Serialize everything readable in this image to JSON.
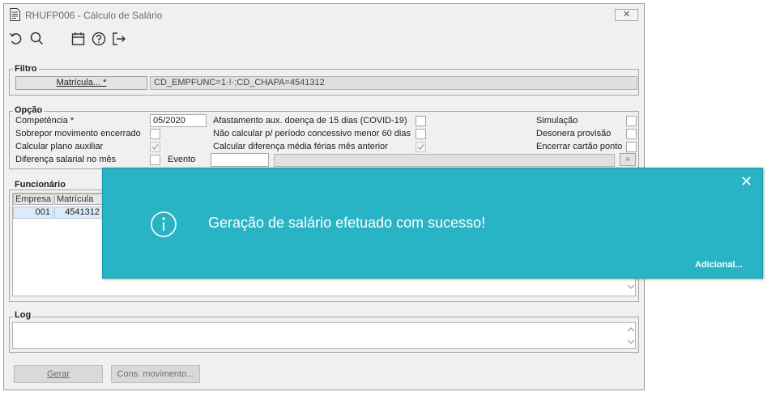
{
  "window": {
    "title": "RHUFP006 - Cálculo de Salário",
    "close_label": "✕"
  },
  "toolbar": {
    "icons": [
      "undo-icon",
      "search-icon",
      "calendar-icon",
      "help-icon",
      "exit-icon"
    ]
  },
  "filtro": {
    "legend": "Filtro",
    "button_label": "Matrícula... *",
    "filter_value": "CD_EMPFUNC=1·!·;CD_CHAPA=4541312"
  },
  "opcao": {
    "legend": "Opção",
    "competencia_label": "Competência *",
    "competencia_value": "05/2020",
    "sobrepor_label": "Sobrepor movimento encerrado",
    "plano_auxiliar_label": "Calcular plano auxiliar",
    "diferenca_salarial_label": "Diferença salarial no mês",
    "evento_label": "Evento",
    "afastamento_label": "Afastamento aux. doença de 15 dias (COVID-19)",
    "nao_calcular_label": "Não calcular p/ período concessivo menor 60 dias",
    "diferenca_media_label": "Calcular diferença média férias mês anterior",
    "simulacao_label": "Simulação",
    "desonera_label": "Desonera provisão",
    "encerrar_label": "Encerrar cartão ponto",
    "lookup_button": "»"
  },
  "funcionario": {
    "legend": "Funcionário",
    "columns": [
      "Empresa",
      "Matrícula"
    ],
    "rows": [
      [
        "001",
        "4541312"
      ]
    ]
  },
  "log": {
    "legend": "Log"
  },
  "footer": {
    "gerar_label": "Gerar",
    "cons_movimento_label": "Cons. movimento..."
  },
  "toast": {
    "message": "Geração de salário efetuado com sucesso!",
    "more_label": "Adicional...",
    "close_glyph": "✕",
    "background": "#29b4c6"
  }
}
